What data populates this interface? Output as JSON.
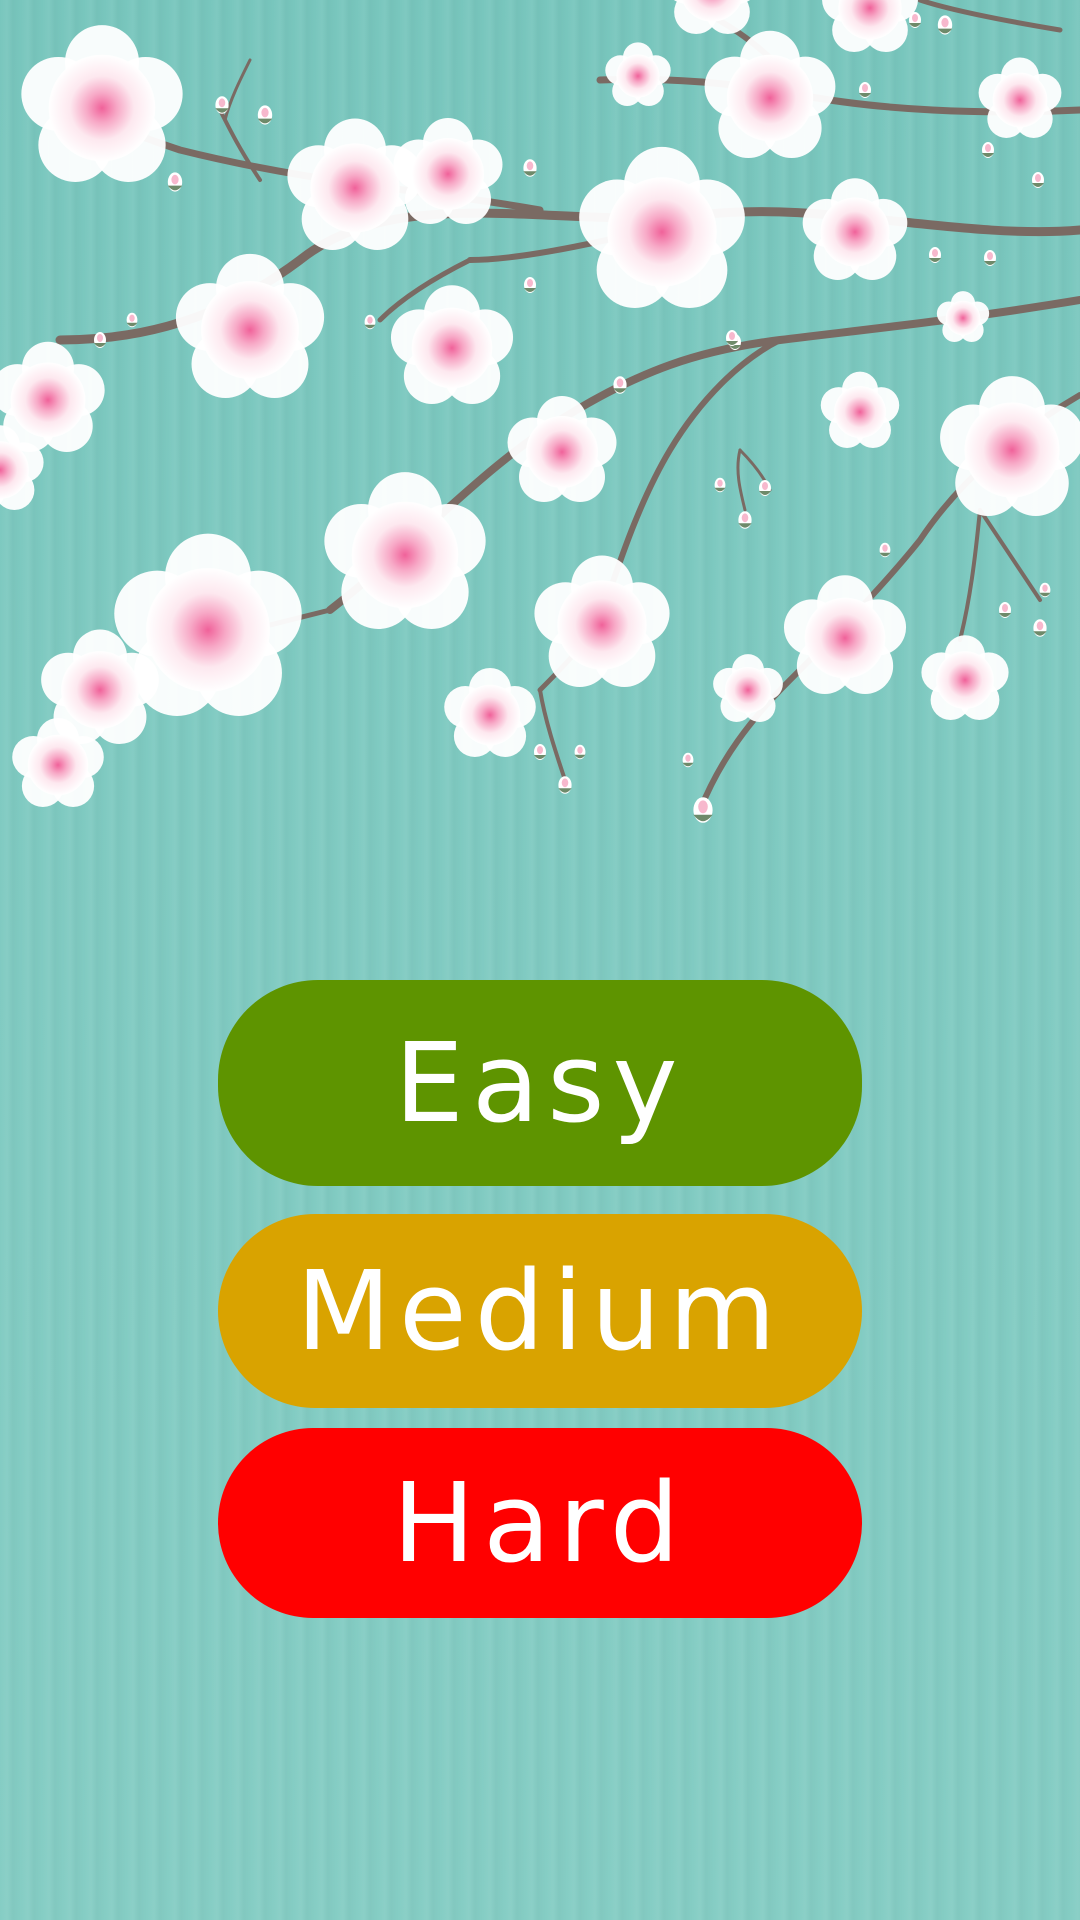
{
  "menu": {
    "buttons": [
      {
        "label": "Easy",
        "color": "#5e9400"
      },
      {
        "label": "Medium",
        "color": "#d9a300"
      },
      {
        "label": "Hard",
        "color": "#ff0000"
      }
    ]
  },
  "theme": {
    "background": "#82cbc2",
    "branch": "#7a6a63",
    "petal": "#ffffff",
    "blossom_center": "#f06a9c"
  }
}
